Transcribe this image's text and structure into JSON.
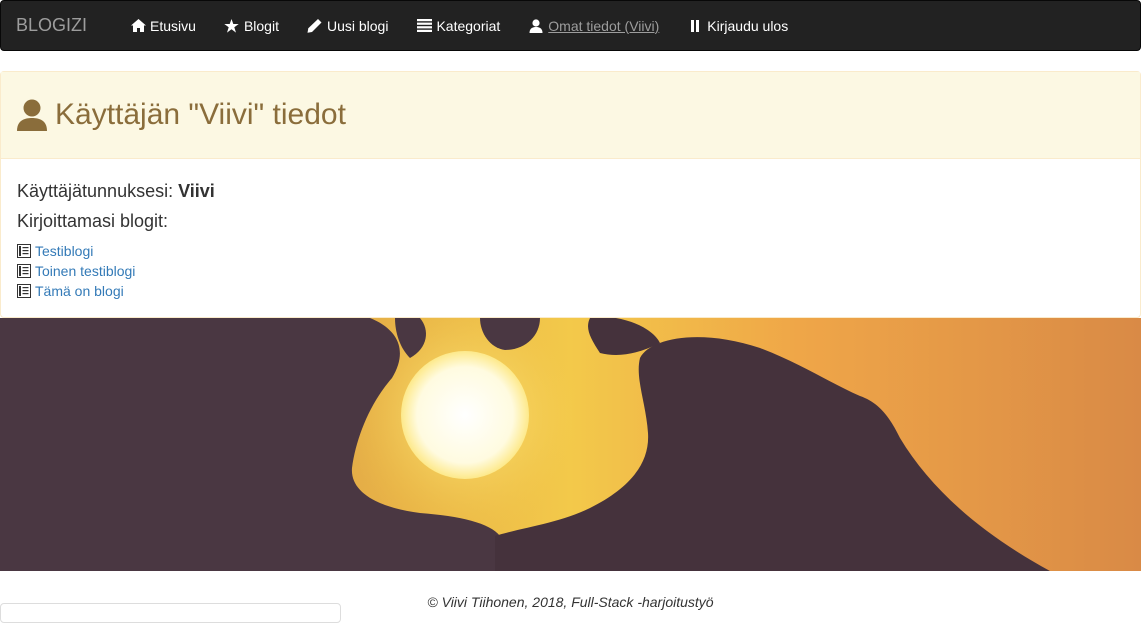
{
  "navbar": {
    "brand": "BLOGIZI",
    "items": [
      {
        "label": "Etusivu",
        "icon": "home-icon"
      },
      {
        "label": "Blogit",
        "icon": "star-icon"
      },
      {
        "label": "Uusi blogi",
        "icon": "pencil-icon"
      },
      {
        "label": "Kategoriat",
        "icon": "list-icon"
      },
      {
        "label": "Omat tiedot (Viivi)",
        "icon": "user-icon"
      },
      {
        "label": "Kirjaudu ulos",
        "icon": "pause-icon"
      }
    ]
  },
  "panel": {
    "title": "Käyttäjän \"Viivi\" tiedot",
    "username_label": "Käyttäjätunnuksesi:",
    "username": "Viivi",
    "blogs_label": "Kirjoittamasi blogit:",
    "blogs": [
      "Testiblogi",
      "Toinen testiblogi",
      "Tämä on blogi"
    ]
  },
  "footer": {
    "text": "© Viivi Tiihonen, 2018, Full-Stack -harjoitustyö"
  },
  "colors": {
    "navbar_bg": "#222222",
    "panel_heading_bg": "#fcf8e3",
    "panel_heading_text": "#8a6d3b",
    "link": "#337ab7"
  }
}
